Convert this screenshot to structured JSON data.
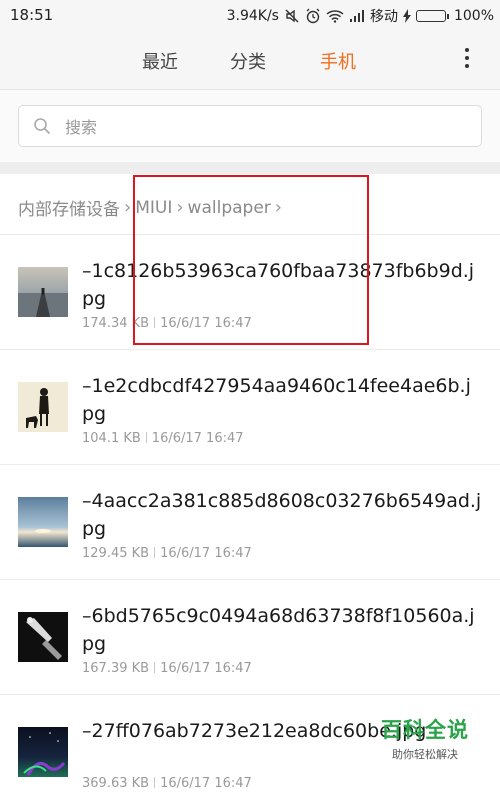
{
  "status_bar": {
    "time": "18:51",
    "network_speed": "3.94K/s",
    "carrier": "移动",
    "battery": "100%",
    "battery_level": 1.0,
    "icons": [
      "mute-icon",
      "alarm-icon",
      "wifi-icon",
      "signal-icon",
      "charging-icon",
      "battery-icon"
    ]
  },
  "tabs": [
    {
      "label": "最近",
      "active": false
    },
    {
      "label": "分类",
      "active": false
    },
    {
      "label": "手机",
      "active": true
    }
  ],
  "colors": {
    "accent": "#f26d1b",
    "annotation_box": "#e0141e",
    "watermark": "#2aa34a"
  },
  "search": {
    "placeholder": "搜索",
    "value": ""
  },
  "breadcrumb": [
    {
      "label": "内部存储设备"
    },
    {
      "label": "MIUI"
    },
    {
      "label": "wallpaper"
    }
  ],
  "files": [
    {
      "name": "–1c8126b53963ca760fbaa73873fb6b9d.jpg",
      "size": "174.34 KB",
      "date": "16/6/17 16:47"
    },
    {
      "name": "–1e2cdbcdf427954aa9460c14fee4ae6b.jpg",
      "size": "104.1 KB",
      "date": "16/6/17 16:47"
    },
    {
      "name": "–4aacc2a381c885d8608c03276b6549ad.jpg",
      "size": "129.45 KB",
      "date": "16/6/17 16:47"
    },
    {
      "name": "–6bd5765c9c0494a68d63738f8f10560a.jpg",
      "size": "167.39 KB",
      "date": "16/6/17 16:47"
    },
    {
      "name": "–27ff076ab7273e212ea8dc60be.jpg",
      "size": "369.63 KB",
      "date": "16/6/17 16:47"
    }
  ],
  "watermark": {
    "title": "百科全说",
    "subtitle": "助你轻松解决"
  }
}
